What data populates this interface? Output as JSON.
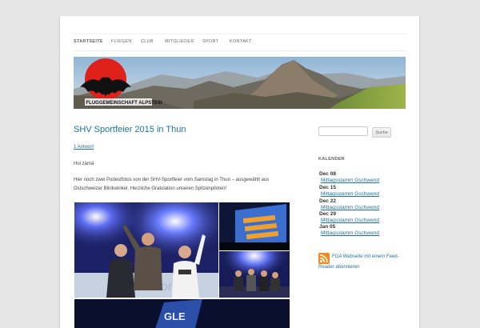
{
  "nav": {
    "items": [
      "Startseite",
      "Fliegen",
      "Club",
      "Mitglieder",
      "Sport",
      "Kontakt"
    ]
  },
  "banner": {
    "logo_text": "FLUGGEMEINSCHAFT ALPSTEIN"
  },
  "post": {
    "title": "SHV Sportfeier 2015 in Thun",
    "reply_link": "1 Antwort",
    "greeting": "Hoi zämä",
    "body": "Hier noch zwei Podestfotos von der SHV-Sportfeier vom Samstag in Thun – ausgewählt aus Ostschweizer Blinkwinkel. Herzliche Gratulation unseren Spitzenpiloten!"
  },
  "sidebar": {
    "search_button": "Suche",
    "search_value": "",
    "calendar_title": "Kalender",
    "calendar": [
      {
        "date": "Dec 08",
        "event": "Mittagsstamm Gschwend"
      },
      {
        "date": "Dec 15",
        "event": "Mittagsstamm Gschwend"
      },
      {
        "date": "Dec 22",
        "event": "Mittagsstamm Gschwend"
      },
      {
        "date": "Dec 29",
        "event": "Mittagsstamm Gschwend"
      },
      {
        "date": "Jan 05",
        "event": "Mittagsstamm Gschwend"
      }
    ],
    "rss_line1": "FGA Webseite mit einem Feed-",
    "rss_line2": "Reader abonnieren"
  },
  "colors": {
    "link": "#21759b",
    "background": "#e6e6e6",
    "logo_sun": "#e0201b",
    "rss": "#f28a1f"
  },
  "icons": {
    "logo": "bat-on-sun-logo",
    "rss": "rss-icon"
  }
}
